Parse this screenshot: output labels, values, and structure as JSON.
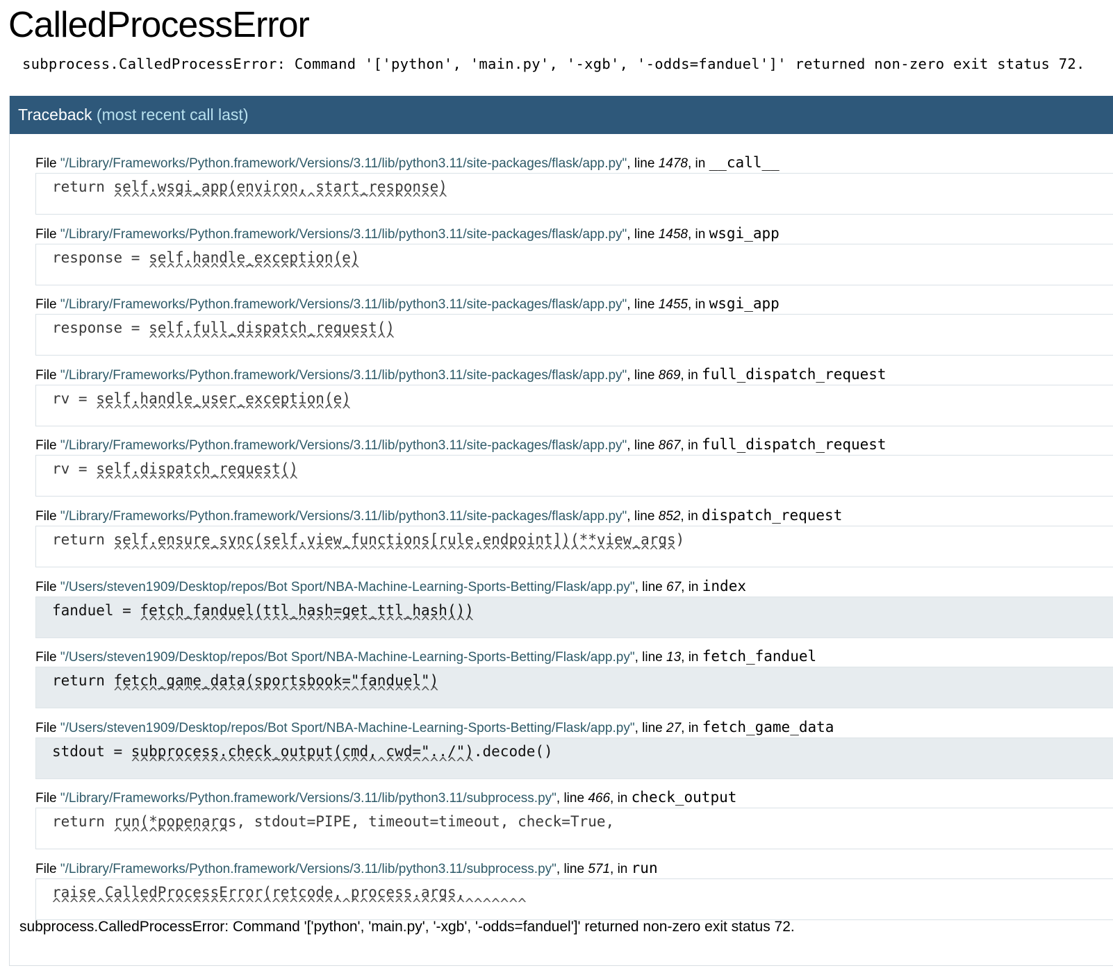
{
  "title": "CalledProcessError",
  "error_message": "subprocess.CalledProcessError: Command '['python', 'main.py', '-xgb', '-odds=fanduel']' returned non-zero exit status 72.",
  "traceback": {
    "header": "Traceback",
    "header_sub": "(most recent call last)"
  },
  "frames": [
    {
      "path": "\"/Library/Frameworks/Python.framework/Versions/3.11/lib/python3.11/site-packages/flask/app.py\"",
      "line": "1478",
      "func": "__call__",
      "code": "return self.wsgi_app(environ, start_response)",
      "carets": "       ^^^^^^^^^^^^^^^^^^^^^^^^^^^^^^^^^^^^^^",
      "app": false
    },
    {
      "path": "\"/Library/Frameworks/Python.framework/Versions/3.11/lib/python3.11/site-packages/flask/app.py\"",
      "line": "1458",
      "func": "wsgi_app",
      "code": "response = self.handle_exception(e)",
      "carets": "           ^^^^^^^^^^^^^^^^^^^^^^^^",
      "app": false
    },
    {
      "path": "\"/Library/Frameworks/Python.framework/Versions/3.11/lib/python3.11/site-packages/flask/app.py\"",
      "line": "1455",
      "func": "wsgi_app",
      "code": "response = self.full_dispatch_request()",
      "carets": "           ^^^^^^^^^^^^^^^^^^^^^^^^^^^^",
      "app": false
    },
    {
      "path": "\"/Library/Frameworks/Python.framework/Versions/3.11/lib/python3.11/site-packages/flask/app.py\"",
      "line": "869",
      "func": "full_dispatch_request",
      "code": "rv = self.handle_user_exception(e)",
      "carets": "     ^^^^^^^^^^^^^^^^^^^^^^^^^^^^^",
      "app": false
    },
    {
      "path": "\"/Library/Frameworks/Python.framework/Versions/3.11/lib/python3.11/site-packages/flask/app.py\"",
      "line": "867",
      "func": "full_dispatch_request",
      "code": "rv = self.dispatch_request()",
      "carets": "     ^^^^^^^^^^^^^^^^^^^^^^^",
      "app": false
    },
    {
      "path": "\"/Library/Frameworks/Python.framework/Versions/3.11/lib/python3.11/site-packages/flask/app.py\"",
      "line": "852",
      "func": "dispatch_request",
      "code": "return self.ensure_sync(self.view_functions[rule.endpoint])(**view_args)",
      "carets": "       ^^^^^^^^^^^^^^^^^^^^^^^^^^^^^^^^^^^^^^^^^^^^^^^^^^^^^^^^^^^^^^^^",
      "app": false
    },
    {
      "path": "\"/Users/steven1909/Desktop/repos/Bot Sport/NBA-Machine-Learning-Sports-Betting/Flask/app.py\"",
      "line": "67",
      "func": "index",
      "code": "fanduel = fetch_fanduel(ttl_hash=get_ttl_hash())",
      "carets": "          ^^^^^^^^^^^^^^^^^^^^^^^^^^^^^^^^^^^^^^",
      "app": true
    },
    {
      "path": "\"/Users/steven1909/Desktop/repos/Bot Sport/NBA-Machine-Learning-Sports-Betting/Flask/app.py\"",
      "line": "13",
      "func": "fetch_fanduel",
      "code": "return fetch_game_data(sportsbook=\"fanduel\")",
      "carets": "       ^^^^^^^^^^^^^^^^^^^^^^^^^^^^^^^^^^^^^",
      "app": true
    },
    {
      "path": "\"/Users/steven1909/Desktop/repos/Bot Sport/NBA-Machine-Learning-Sports-Betting/Flask/app.py\"",
      "line": "27",
      "func": "fetch_game_data",
      "code": "stdout = subprocess.check_output(cmd, cwd=\"../\").decode()",
      "carets": "         ^^^^^^^^^^^^^^^^^^^^^^^^^^^^^^^^^^^^^^^",
      "app": true
    },
    {
      "path": "\"/Library/Frameworks/Python.framework/Versions/3.11/lib/python3.11/subprocess.py\"",
      "line": "466",
      "func": "check_output",
      "code": "return run(*popenargs, stdout=PIPE, timeout=timeout, check=True,",
      "carets": "       ^^^^^^^^^^^^^",
      "app": false
    },
    {
      "path": "\"/Library/Frameworks/Python.framework/Versions/3.11/lib/python3.11/subprocess.py\"",
      "line": "571",
      "func": "run",
      "code": "raise CalledProcessError(retcode, process.args,",
      "carets": "^^^^^^^^^^^^^^^^^^^^^^^^^^^^^^^^^^^^^^^^^^^^^^^^^^^^^^",
      "app": false
    }
  ],
  "labels": {
    "file": "File ",
    "line": ", line ",
    "in": ", in "
  },
  "footer_message": "subprocess.CalledProcessError: Command '['python', 'main.py', '-xgb', '-odds=fanduel']' returned non-zero exit status 72."
}
